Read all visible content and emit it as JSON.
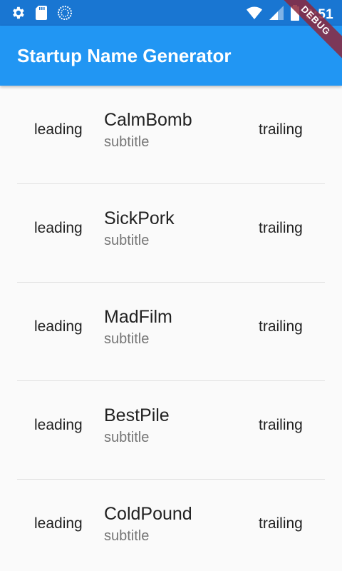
{
  "status_bar": {
    "time": "3:51",
    "left_icons": [
      "gear-icon",
      "sd-card-icon",
      "sync-icon"
    ],
    "right_icons": [
      "wifi-icon",
      "signal-icon",
      "battery-icon"
    ],
    "color": "#1976d2"
  },
  "app_bar": {
    "title": "Startup Name Generator",
    "color": "#2196f3"
  },
  "debug_banner": {
    "label": "DEBUG"
  },
  "list": {
    "items": [
      {
        "leading": "leading",
        "title": "CalmBomb",
        "subtitle": "subtitle",
        "trailing": "trailing"
      },
      {
        "leading": "leading",
        "title": "SickPork",
        "subtitle": "subtitle",
        "trailing": "trailing"
      },
      {
        "leading": "leading",
        "title": "MadFilm",
        "subtitle": "subtitle",
        "trailing": "trailing"
      },
      {
        "leading": "leading",
        "title": "BestPile",
        "subtitle": "subtitle",
        "trailing": "trailing"
      },
      {
        "leading": "leading",
        "title": "ColdPound",
        "subtitle": "subtitle",
        "trailing": "trailing"
      }
    ]
  }
}
